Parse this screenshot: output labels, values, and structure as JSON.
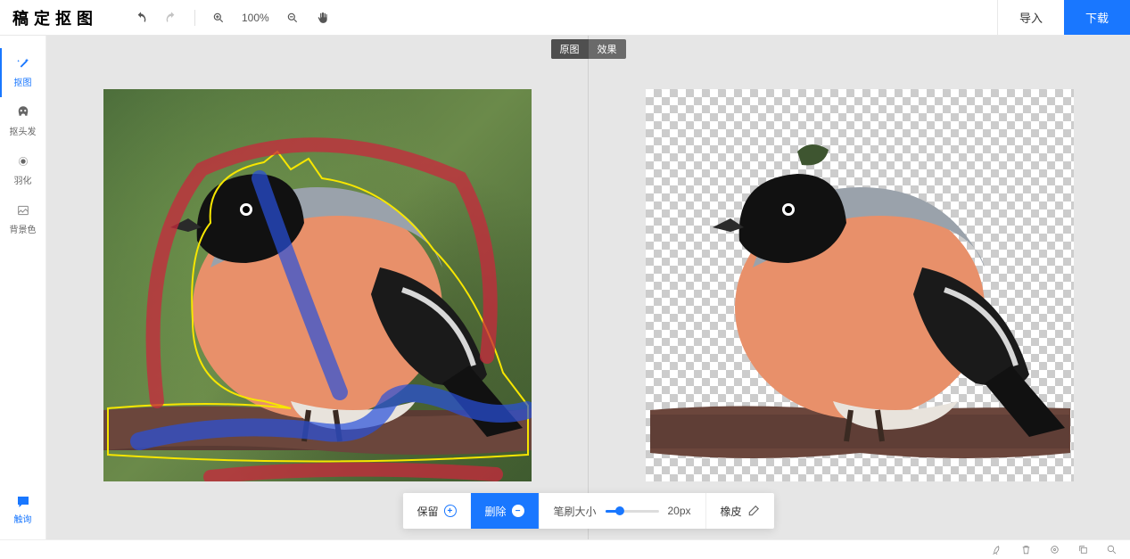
{
  "logo": "稿定抠图",
  "toolbar": {
    "zoom": "100%"
  },
  "header_buttons": {
    "import": "导入",
    "download": "下载"
  },
  "sidebar": {
    "items": [
      {
        "label": "抠图"
      },
      {
        "label": "抠头发"
      },
      {
        "label": "羽化"
      },
      {
        "label": "背景色"
      }
    ],
    "chat": "触询"
  },
  "view_tabs": {
    "original": "原图",
    "result": "效果"
  },
  "bottom_bar": {
    "keep": "保留",
    "remove": "删除",
    "brush_label": "笔刷大小",
    "brush_value": "20px",
    "eraser": "橡皮"
  }
}
